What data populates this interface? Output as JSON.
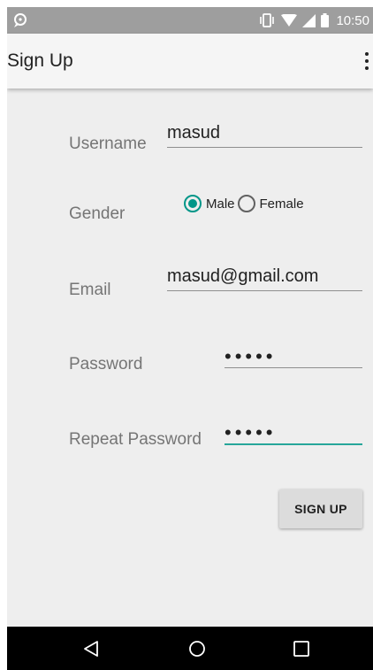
{
  "status_bar": {
    "time": "10:50"
  },
  "app_bar": {
    "title": "Sign Up"
  },
  "form": {
    "username": {
      "label": "Username",
      "value": "masud"
    },
    "gender": {
      "label": "Gender",
      "options": [
        {
          "label": "Male",
          "checked": true
        },
        {
          "label": "Female",
          "checked": false
        }
      ]
    },
    "email": {
      "label": "Email",
      "value": "masud@gmail.com"
    },
    "password": {
      "label": "Password",
      "value": "•••••"
    },
    "repeat_password": {
      "label": "Repeat Password",
      "value": "•••••"
    },
    "submit_label": "SIGN UP"
  },
  "colors": {
    "accent": "#009688",
    "focus_underline": "#26a69a",
    "status_bar": "#9e9e9e",
    "background": "#eeeeee"
  }
}
